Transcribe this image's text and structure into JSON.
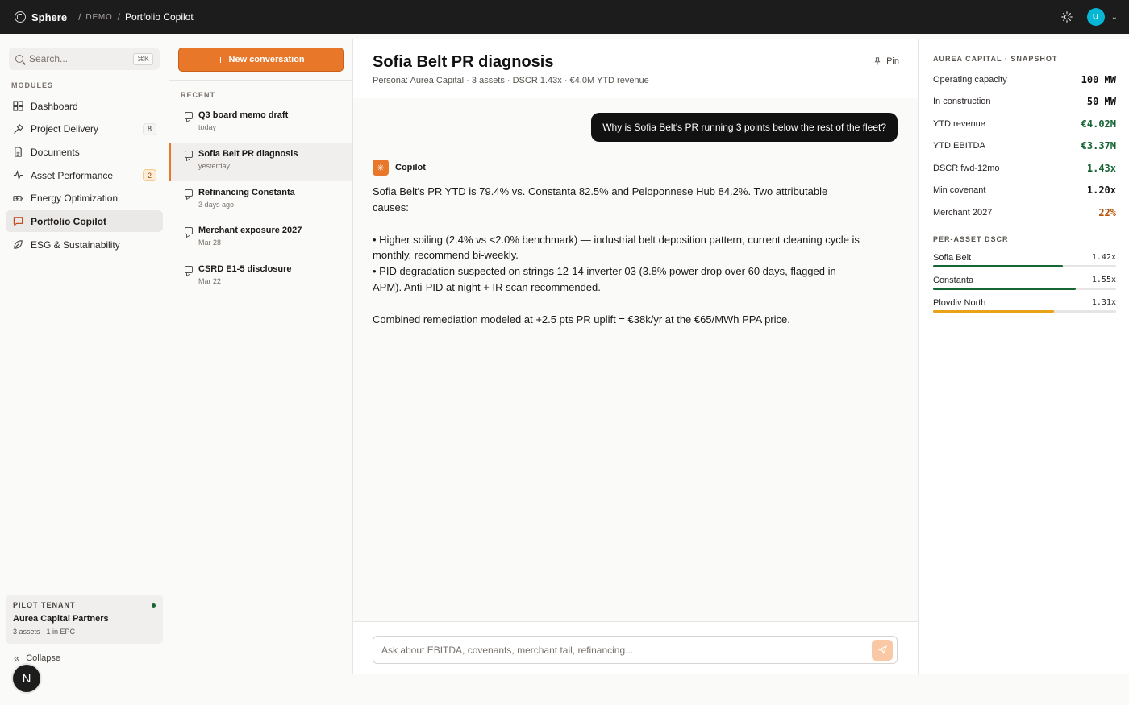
{
  "topbar": {
    "brand": "Sphere",
    "crumb_demo": "DEMO",
    "crumb_current": "Portfolio Copilot",
    "avatar_initial": "U"
  },
  "sidebar": {
    "search_placeholder": "Search...",
    "search_shortcut": "⌘K",
    "modules_label": "MODULES",
    "items": [
      {
        "label": "Dashboard",
        "icon": "grid-icon",
        "badge": ""
      },
      {
        "label": "Project Delivery",
        "icon": "hammer-icon",
        "badge": "8"
      },
      {
        "label": "Documents",
        "icon": "document-icon",
        "badge": ""
      },
      {
        "label": "Asset Performance",
        "icon": "pulse-icon",
        "badge": "2"
      },
      {
        "label": "Energy Optimization",
        "icon": "battery-icon",
        "badge": ""
      },
      {
        "label": "Portfolio Copilot",
        "icon": "chat-icon",
        "badge": "",
        "active": true
      },
      {
        "label": "ESG & Sustainability",
        "icon": "leaf-icon",
        "badge": ""
      }
    ],
    "tenant": {
      "label": "PILOT TENANT",
      "name": "Aurea Capital Partners",
      "sub": "3 assets · 1 in EPC"
    },
    "collapse_label": "Collapse",
    "n_button": "N"
  },
  "conversations": {
    "new_label": "New conversation",
    "recent_label": "RECENT",
    "items": [
      {
        "title": "Q3 board memo draft",
        "date": "today"
      },
      {
        "title": "Sofia Belt PR diagnosis",
        "date": "yesterday",
        "active": true
      },
      {
        "title": "Refinancing Constanta",
        "date": "3 days ago"
      },
      {
        "title": "Merchant exposure 2027",
        "date": "Mar 28"
      },
      {
        "title": "CSRD E1-5 disclosure",
        "date": "Mar 22"
      }
    ]
  },
  "chat": {
    "title": "Sofia Belt PR diagnosis",
    "meta": "Persona: Aurea Capital · 3 assets · DSCR 1.43x · €4.0M YTD revenue",
    "pin_label": "Pin",
    "user_message": "Why is Sofia Belt's PR running 3 points below the rest of the fleet?",
    "assistant_name": "Copilot",
    "answer": {
      "p1": "Sofia Belt's PR YTD is 79.4% vs. Constanta 82.5% and Peloponnese Hub 84.2%. Two attributable causes:",
      "b1": "• Higher soiling (2.4% vs <2.0% benchmark) — industrial belt deposition pattern, current cleaning cycle is monthly, recommend bi-weekly.",
      "b2": "• PID degradation suspected on strings 12-14 inverter 03 (3.8% power drop over 60 days, flagged in APM). Anti-PID at night + IR scan recommended.",
      "p2": "Combined remediation modeled at +2.5 pts PR uplift = €38k/yr at the €65/MWh PPA price."
    },
    "composer_placeholder": "Ask about EBITDA, covenants, merchant tail, refinancing..."
  },
  "snapshot": {
    "label": "AUREA CAPITAL · SNAPSHOT",
    "kpis": [
      {
        "label": "Operating capacity",
        "value": "100 MW",
        "tone": "default"
      },
      {
        "label": "In construction",
        "value": "50 MW",
        "tone": "default"
      },
      {
        "label": "YTD revenue",
        "value": "€4.02M",
        "tone": "green"
      },
      {
        "label": "YTD EBITDA",
        "value": "€3.37M",
        "tone": "green"
      },
      {
        "label": "DSCR fwd-12mo",
        "value": "1.43x",
        "tone": "green"
      },
      {
        "label": "Min covenant",
        "value": "1.20x",
        "tone": "default"
      },
      {
        "label": "Merchant 2027",
        "value": "22%",
        "tone": "amber"
      }
    ],
    "dscr_label": "PER-ASSET DSCR",
    "dscr": [
      {
        "asset": "Sofia Belt",
        "value": "1.42x",
        "fill": 0.71,
        "color": "#166534"
      },
      {
        "asset": "Constanta",
        "value": "1.55x",
        "fill": 0.78,
        "color": "#166534"
      },
      {
        "asset": "Plovdiv North",
        "value": "1.31x",
        "fill": 0.66,
        "color": "#e8a317"
      }
    ]
  }
}
